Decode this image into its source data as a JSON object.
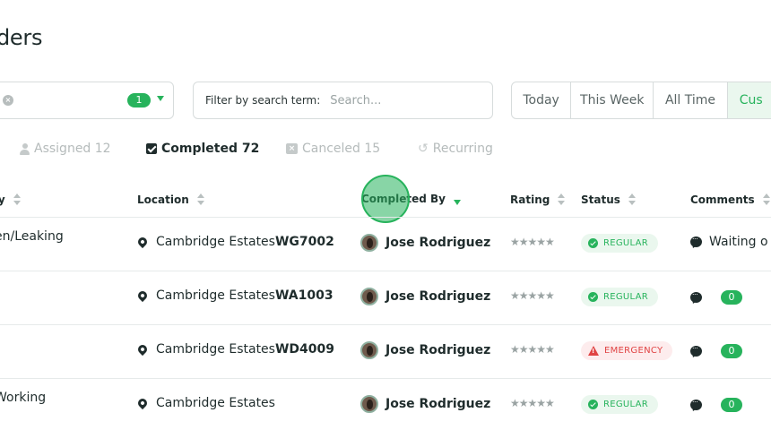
{
  "page": {
    "title": "ders"
  },
  "filters": {
    "selected_count": "1",
    "search_label": "Filter by search term:",
    "search_placeholder": "Search...",
    "search_value": "",
    "date_ranges": [
      "Today",
      "This Week",
      "All Time",
      "Cus"
    ],
    "active_range": "Cus"
  },
  "tabs": [
    {
      "label": "Assigned 12",
      "icon": "person-icon",
      "active": false
    },
    {
      "label": "Completed 72",
      "icon": "checkbox-icon",
      "active": true
    },
    {
      "label": "Canceled 15",
      "icon": "x-box-icon",
      "active": false
    },
    {
      "label": "Recurring",
      "icon": "recurring-icon",
      "active": false
    }
  ],
  "table": {
    "columns": [
      "ry",
      "Location",
      "Completed By",
      "Rating",
      "Status",
      "Comments"
    ],
    "sorted_column": "Completed By",
    "rows": [
      {
        "category": "en/Leaking",
        "location": "Cambridge Estates",
        "code": "WG7002",
        "tech": "Jose Rodriguez",
        "rating": "★★★★★",
        "status": "REGULAR",
        "comment": "Waiting o",
        "comment_count": ""
      },
      {
        "category": "",
        "location": "Cambridge Estates",
        "code": "WA1003",
        "tech": "Jose Rodriguez",
        "rating": "★★★★★",
        "status": "REGULAR",
        "comment": "",
        "comment_count": "0"
      },
      {
        "category": "",
        "location": "Cambridge Estates",
        "code": "WD4009",
        "tech": "Jose Rodriguez",
        "rating": "★★★★★",
        "status": "EMERGENCY",
        "comment": "",
        "comment_count": "0"
      },
      {
        "category": "Working",
        "location": "Cambridge Estates",
        "code": "",
        "tech": "Jose Rodriguez",
        "rating": "★★★★★",
        "status": "REGULAR",
        "comment": "",
        "comment_count": "0"
      }
    ]
  },
  "colors": {
    "accent": "#27b35c",
    "text": "#1f2c2c",
    "emergency": "#e04343",
    "muted": "#b5bbbb"
  }
}
